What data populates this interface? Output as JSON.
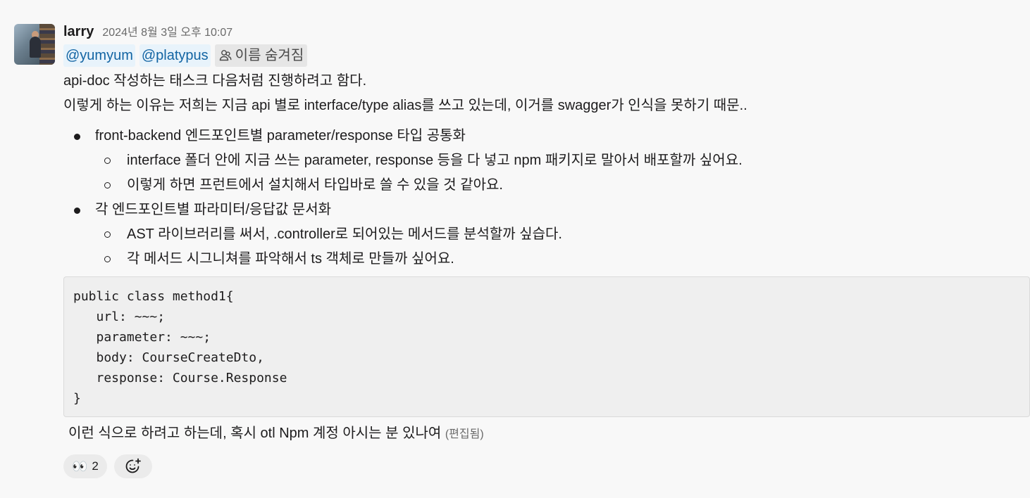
{
  "message": {
    "username": "larry",
    "timestamp": "2024년 8월 3일 오후 10:07",
    "mentions": [
      "@yumyum",
      "@platypus"
    ],
    "hidden_mention": "이름 숨겨짐",
    "intro_lines": [
      "api-doc 작성하는 태스크 다음처럼 진행하려고 함다.",
      "이렇게 하는 이유는 저희는 지금 api 별로 interface/type alias를 쓰고 있는데, 이거를 swagger가 인식을 못하기 때문.."
    ],
    "bullets": [
      {
        "text": "front-backend 엔드포인트별 parameter/response 타입 공통화",
        "sub": [
          "interface 폴더 안에 지금 쓰는 parameter, response 등을 다 넣고 npm 패키지로 말아서 배포할까 싶어요.",
          "이렇게 하면 프런트에서 설치해서 타입바로 쓸 수 있을 것 같아요."
        ]
      },
      {
        "text": "각 엔드포인트별 파라미터/응답값 문서화",
        "sub": [
          "AST 라이브러리를 써서, .controller로 되어있는 메서드를 분석할까 싶습다.",
          "각 메서드 시그니쳐를 파악해서 ts 객체로 만들까 싶어요."
        ]
      }
    ],
    "code_block": "public class method1{\n   url: ~~~;\n   parameter: ~~~;\n   body: CourseCreateDto,\n   response: Course.Response\n}",
    "closing_text": "이런 식으로 하려고 하는데, 혹시 otl Npm 계정 아시는 분 있나여",
    "edited_label": "(편집됨)",
    "reactions": [
      {
        "emoji": "👀",
        "count": "2"
      }
    ],
    "add_reaction_icon": "add-emoji-icon"
  }
}
